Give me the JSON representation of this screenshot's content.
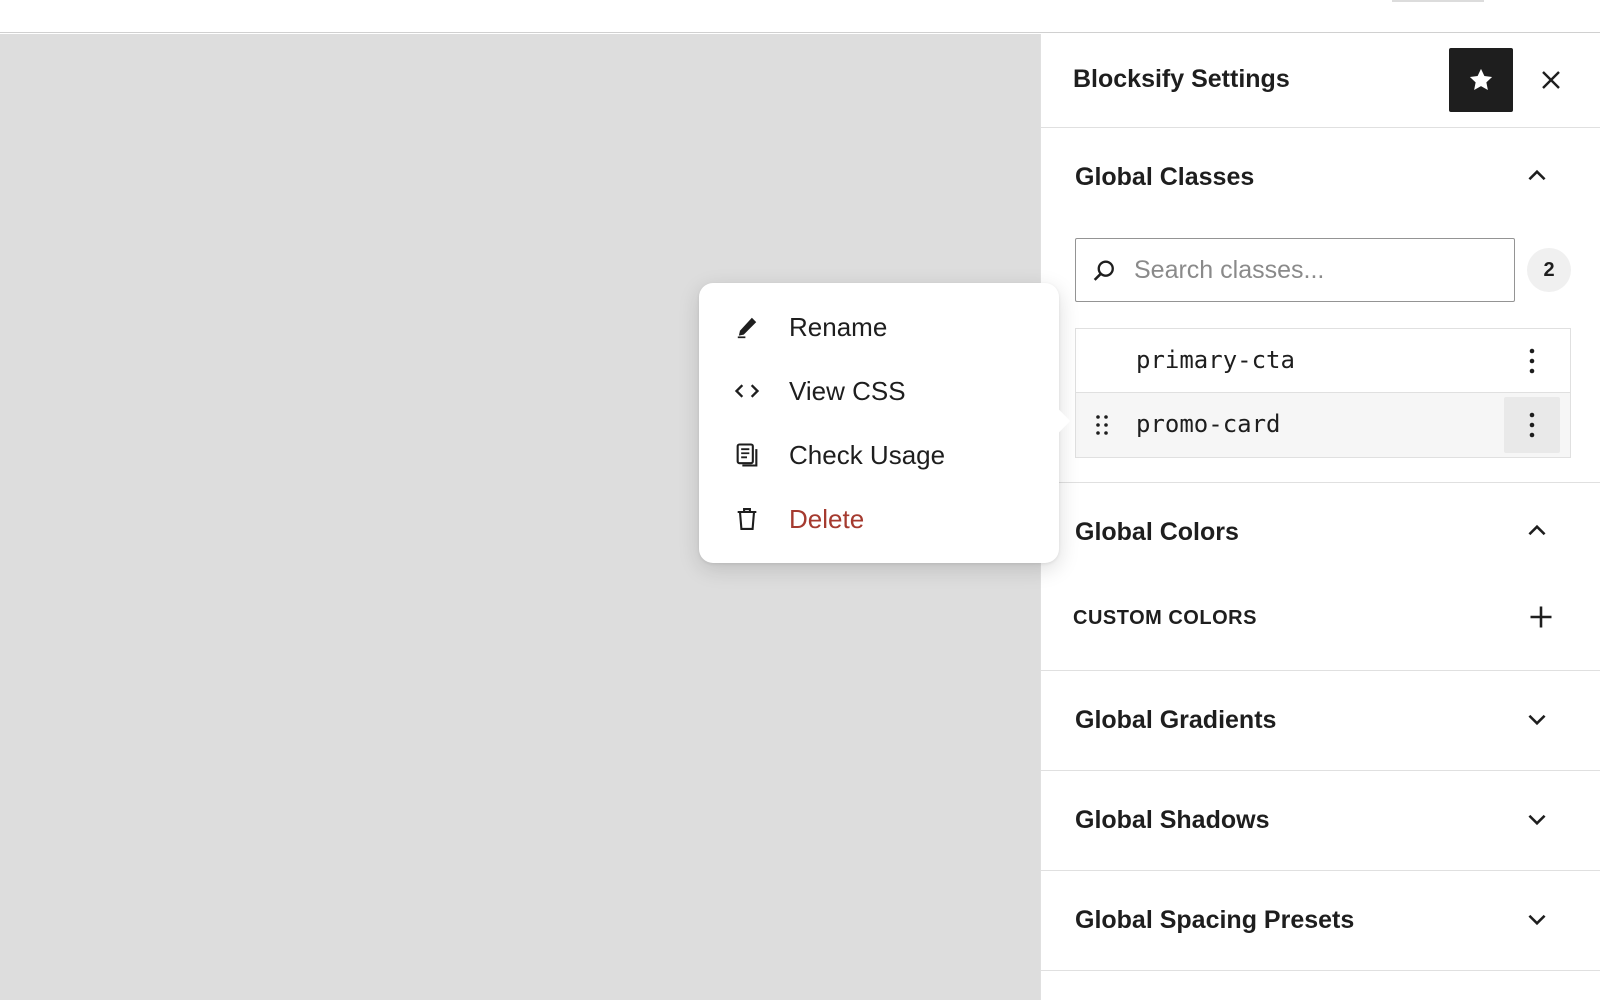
{
  "sidebar": {
    "title": "Blocksify Settings",
    "star_icon": "star-icon",
    "close_icon": "close-icon"
  },
  "global_classes": {
    "title": "Global Classes",
    "expanded": true,
    "search": {
      "placeholder": "Search classes...",
      "value": ""
    },
    "count": "2",
    "items": [
      {
        "name": "primary-cta"
      },
      {
        "name": "promo-card"
      }
    ]
  },
  "global_colors": {
    "title": "Global Colors",
    "expanded": true,
    "custom_colors_label": "CUSTOM COLORS"
  },
  "collapsed_panels": [
    {
      "title": "Global Gradients",
      "expanded": false
    },
    {
      "title": "Global Shadows",
      "expanded": false
    },
    {
      "title": "Global Spacing Presets",
      "expanded": false
    }
  ],
  "context_menu": {
    "items": [
      {
        "label": "Rename",
        "icon": "pencil-icon"
      },
      {
        "label": "View CSS",
        "icon": "code-icon"
      },
      {
        "label": "Check Usage",
        "icon": "document-icon"
      },
      {
        "label": "Delete",
        "icon": "trash-icon",
        "color": "#a53a2f"
      }
    ]
  },
  "colors": {
    "canvas": "#dddddd",
    "accent_dark": "#1e1e1e",
    "danger": "#a53a2f"
  }
}
